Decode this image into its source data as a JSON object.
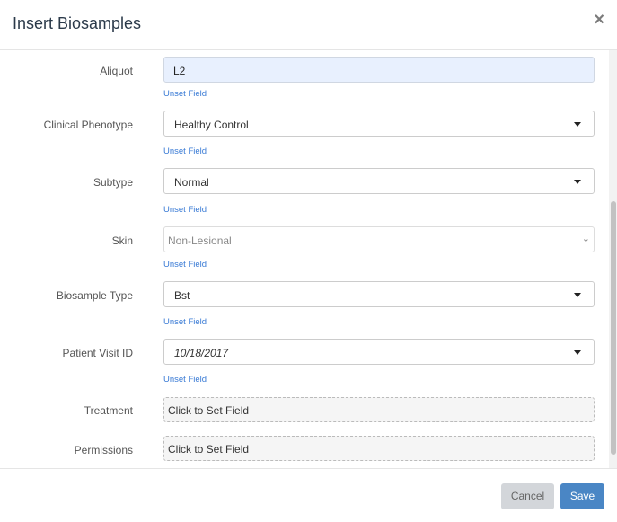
{
  "modal": {
    "title": "Insert Biosamples",
    "close_glyph": "×"
  },
  "unset_label": "Unset Field",
  "fields": {
    "aliquot": {
      "label": "Aliquot",
      "value": "L2"
    },
    "clinical_phenotype": {
      "label": "Clinical Phenotype",
      "value": "Healthy Control"
    },
    "subtype": {
      "label": "Subtype",
      "value": "Normal"
    },
    "skin": {
      "label": "Skin",
      "value": "Non-Lesional",
      "chevron": "⌄"
    },
    "biosample_type": {
      "label": "Biosample Type",
      "value": "Bst"
    },
    "patient_visit_id": {
      "label": "Patient Visit ID",
      "value": "10/18/2017"
    },
    "treatment": {
      "label": "Treatment",
      "value": "Click to Set Field"
    },
    "permissions": {
      "label": "Permissions",
      "value": "Click to Set Field"
    }
  },
  "footer": {
    "cancel_label": "Cancel",
    "save_label": "Save"
  },
  "colors": {
    "save_button": "#4a86c5",
    "unset_link": "#3a7bd5",
    "autofill_bg": "#e8f0fe"
  },
  "icons": {
    "close": "close-icon",
    "caret": "caret-down-icon",
    "chevron": "chevron-down-icon"
  }
}
